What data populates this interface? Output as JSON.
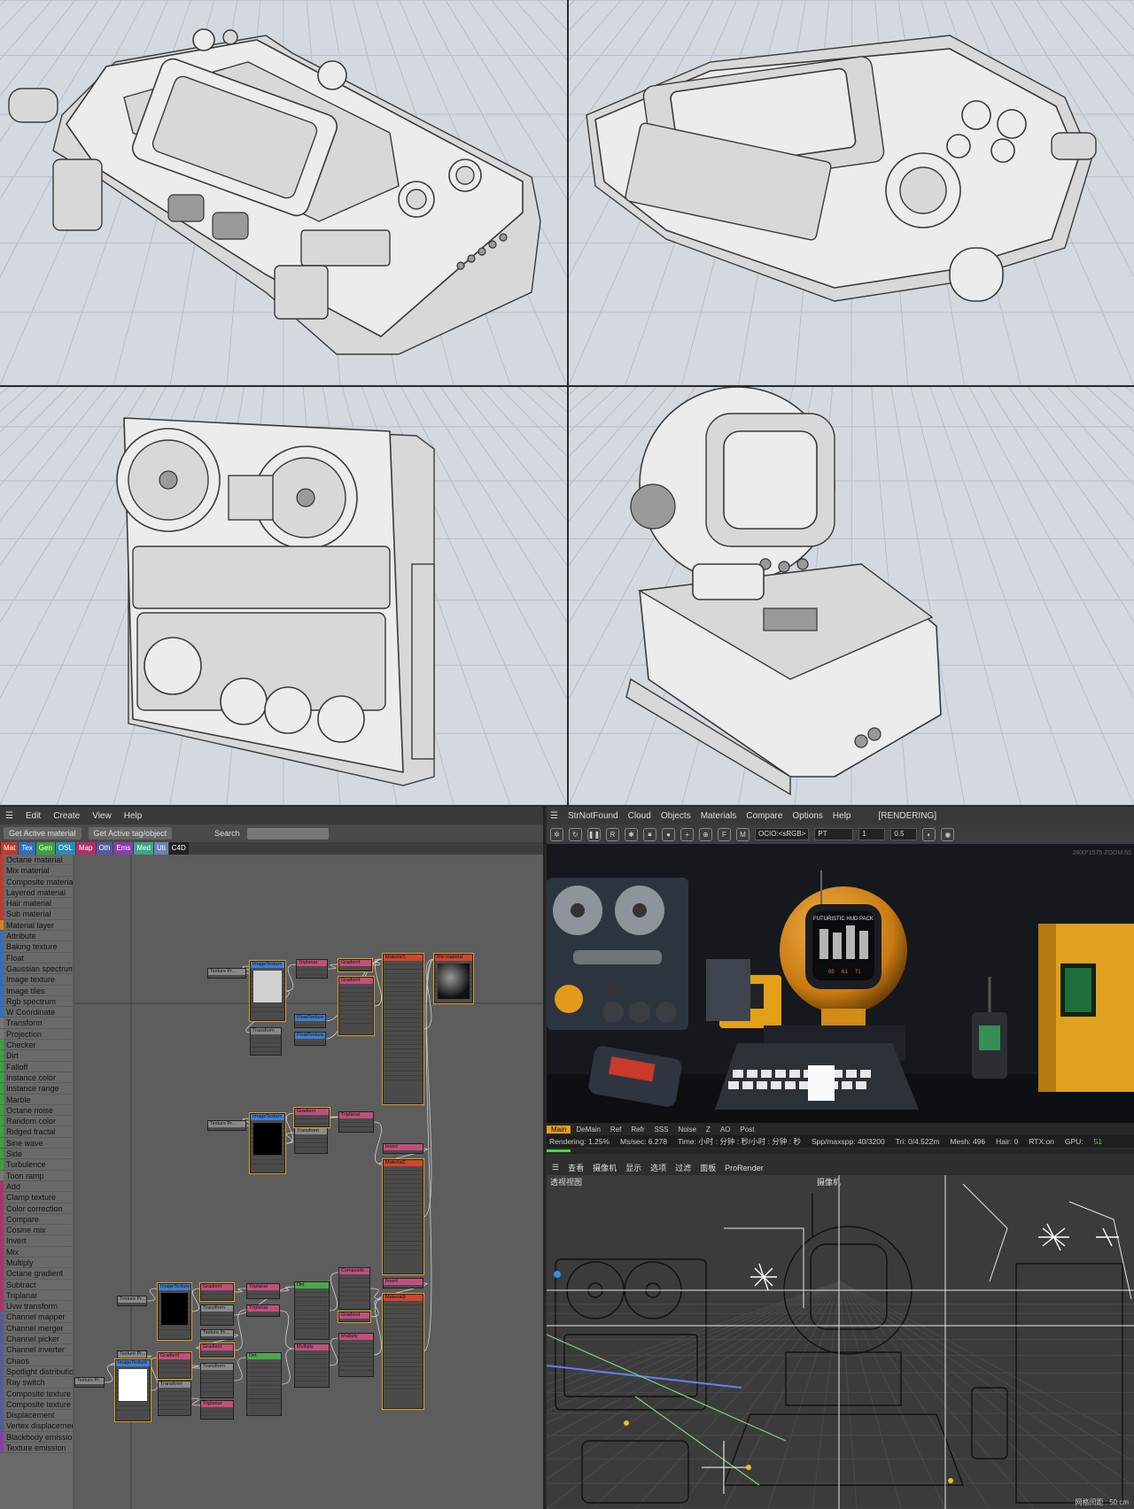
{
  "node_editor": {
    "menu": [
      "Edit",
      "Create",
      "View",
      "Help"
    ],
    "buttons": {
      "get_material": "Get Active material",
      "get_tag": "Get Active tag/object",
      "search_label": "Search"
    },
    "tabs": [
      {
        "label": "Mat",
        "color": "#c0392b"
      },
      {
        "label": "Tex",
        "color": "#2e6fbf"
      },
      {
        "label": "Gen",
        "color": "#39a539"
      },
      {
        "label": "OSL",
        "color": "#2a8ab5"
      },
      {
        "label": "Map",
        "color": "#b0306a"
      },
      {
        "label": "Oth",
        "color": "#555a9a"
      },
      {
        "label": "Ems",
        "color": "#8c3bb0"
      },
      {
        "label": "Med",
        "color": "#3ba58c"
      },
      {
        "label": "Uti",
        "color": "#6a84b5"
      },
      {
        "label": "C4D",
        "color": "#222222"
      }
    ],
    "categories": [
      {
        "label": "Octane material",
        "color": "#c0392b"
      },
      {
        "label": "Mix material",
        "color": "#c0392b"
      },
      {
        "label": "Composite material",
        "color": "#c0392b"
      },
      {
        "label": "Layered material",
        "color": "#c0392b"
      },
      {
        "label": "Hair material",
        "color": "#c0392b"
      },
      {
        "label": "Sub material",
        "color": "#c0392b"
      },
      {
        "label": "Material layer",
        "color": "#e07b20"
      },
      {
        "label": "Attribute",
        "color": "#2e6fbf"
      },
      {
        "label": "Baking texture",
        "color": "#2e6fbf"
      },
      {
        "label": "Float",
        "color": "#2e6fbf"
      },
      {
        "label": "Gaussian spectrum",
        "color": "#2e6fbf"
      },
      {
        "label": "Image texture",
        "color": "#2e6fbf"
      },
      {
        "label": "Image tiles",
        "color": "#2e6fbf"
      },
      {
        "label": "Rgb spectrum",
        "color": "#2e6fbf"
      },
      {
        "label": "W Coordinate",
        "color": "#2e6fbf"
      },
      {
        "label": "Transform",
        "color": "#777777"
      },
      {
        "label": "Projection",
        "color": "#777777"
      },
      {
        "label": "Checker",
        "color": "#39a539"
      },
      {
        "label": "Dirt",
        "color": "#39a539"
      },
      {
        "label": "Falloff",
        "color": "#39a539"
      },
      {
        "label": "Instance color",
        "color": "#39a539"
      },
      {
        "label": "Instance range",
        "color": "#39a539"
      },
      {
        "label": "Marble",
        "color": "#39a539"
      },
      {
        "label": "Octane noise",
        "color": "#39a539"
      },
      {
        "label": "Random color",
        "color": "#39a539"
      },
      {
        "label": "Ridged fractal",
        "color": "#39a539"
      },
      {
        "label": "Sine wave",
        "color": "#39a539"
      },
      {
        "label": "Side",
        "color": "#39a539"
      },
      {
        "label": "Turbulence",
        "color": "#39a539"
      },
      {
        "label": "Toon ramp",
        "color": "#777777"
      },
      {
        "label": "Add",
        "color": "#b0306a"
      },
      {
        "label": "Clamp texture",
        "color": "#b0306a"
      },
      {
        "label": "Color correction",
        "color": "#b0306a"
      },
      {
        "label": "Compare",
        "color": "#b0306a"
      },
      {
        "label": "Cosine mix",
        "color": "#b0306a"
      },
      {
        "label": "Invert",
        "color": "#b0306a"
      },
      {
        "label": "Mix",
        "color": "#b0306a"
      },
      {
        "label": "Multiply",
        "color": "#b0306a"
      },
      {
        "label": "Octane gradient",
        "color": "#b0306a"
      },
      {
        "label": "Subtract",
        "color": "#b0306a"
      },
      {
        "label": "Triplanar",
        "color": "#b0306a"
      },
      {
        "label": "Uvw transform",
        "color": "#b0306a"
      },
      {
        "label": "Channel mapper",
        "color": "#555a9a"
      },
      {
        "label": "Channel merger",
        "color": "#555a9a"
      },
      {
        "label": "Channel picker",
        "color": "#555a9a"
      },
      {
        "label": "Channel inverter",
        "color": "#555a9a"
      },
      {
        "label": "Chaos",
        "color": "#555a9a"
      },
      {
        "label": "Spotlight distribution",
        "color": "#555a9a"
      },
      {
        "label": "Ray switch",
        "color": "#555a9a"
      },
      {
        "label": "Composite texture",
        "color": "#555a9a"
      },
      {
        "label": "Composite texture layer",
        "color": "#555a9a"
      },
      {
        "label": "Displacement",
        "color": "#555a9a"
      },
      {
        "label": "Vertex displacement",
        "color": "#555a9a"
      },
      {
        "label": "Blackbody emission",
        "color": "#8c3bb0"
      },
      {
        "label": "Texture emission",
        "color": "#8c3bb0"
      }
    ],
    "nodes": [
      {
        "title": "Texture Pr...",
        "kind": "util"
      },
      {
        "title": "ImageTexture",
        "kind": "tex"
      },
      {
        "title": "Transform",
        "kind": "util"
      },
      {
        "title": "Triplanar",
        "kind": "map"
      },
      {
        "title": "Gradient",
        "kind": "map"
      },
      {
        "title": "Gradient",
        "kind": "map"
      },
      {
        "title": "Material1",
        "kind": "mat"
      },
      {
        "title": "FloatTexture",
        "kind": "tex"
      },
      {
        "title": "FloatTexture",
        "kind": "tex"
      },
      {
        "title": "Texture Pr...",
        "kind": "util"
      },
      {
        "title": "ImageTexture",
        "kind": "tex"
      },
      {
        "title": "Transform",
        "kind": "util"
      },
      {
        "title": "Gradient",
        "kind": "map"
      },
      {
        "title": "Triplanar",
        "kind": "map"
      },
      {
        "title": "Invert",
        "kind": "map"
      },
      {
        "title": "Material2",
        "kind": "mat"
      },
      {
        "title": "Composite...",
        "kind": "map"
      },
      {
        "title": "Gradient",
        "kind": "map"
      },
      {
        "title": "Multiply",
        "kind": "map"
      },
      {
        "title": "Invert",
        "kind": "map"
      },
      {
        "title": "Material3",
        "kind": "mat"
      },
      {
        "title": "Texture Pr...",
        "kind": "util"
      },
      {
        "title": "ImageTexture",
        "kind": "tex"
      },
      {
        "title": "Gradient",
        "kind": "map"
      },
      {
        "title": "Triplanar",
        "kind": "map"
      },
      {
        "title": "Dirt",
        "kind": "gen"
      },
      {
        "title": "Transform",
        "kind": "util"
      },
      {
        "title": "Texture Pr...",
        "kind": "util"
      },
      {
        "title": "Gradient",
        "kind": "map"
      },
      {
        "title": "Triplanar",
        "kind": "map"
      },
      {
        "title": "Multiply",
        "kind": "map"
      },
      {
        "title": "Texture Pr...",
        "kind": "util"
      },
      {
        "title": "ImageTexture",
        "kind": "tex"
      },
      {
        "title": "Gradient",
        "kind": "map"
      },
      {
        "title": "Transform",
        "kind": "util"
      },
      {
        "title": "Transform",
        "kind": "util"
      },
      {
        "title": "Triplanar",
        "kind": "map"
      },
      {
        "title": "Dirt",
        "kind": "gen"
      },
      {
        "title": "Texture Pr...",
        "kind": "util"
      },
      {
        "title": "Mix material",
        "kind": "mat"
      }
    ]
  },
  "render_window": {
    "menu": [
      "StrNotFound",
      "Cloud",
      "Objects",
      "Materials",
      "Compare",
      "Options",
      "Help"
    ],
    "state": "[RENDERING]",
    "ocio": "OCIO:<sRGB>",
    "kernel": "PT",
    "value1": "1",
    "value2": "0.5",
    "resolution_overlay": "2800*1575 ZOOM:55",
    "hud_label": "FUTURISTIC HUD PACK",
    "scene_nums": [
      "95",
      "61",
      "71"
    ],
    "tabs": [
      "Main",
      "DeMain",
      "Ref",
      "Refr",
      "SSS",
      "Noise",
      "Z",
      "AO",
      "Post"
    ],
    "status": {
      "rendering": "Rendering: 1.25%",
      "ms": "Ms/sec: 6.278",
      "time": "Time: 小时 : 分钟 : 秒/小时 : 分钟 : 秒",
      "spp": "Spp/maxspp: 40/3200",
      "tri": "Tri: 0/4.522m",
      "mesh": "Mesh: 496",
      "hair": "Hair: 0",
      "rtx": "RTX:on",
      "gpu": "GPU:",
      "gpu_val": "51"
    },
    "progress": 0.0125
  },
  "c4d_viewport": {
    "menu": [
      "查看",
      "摄像机",
      "显示",
      "选项",
      "过滤",
      "面板",
      "ProRender"
    ],
    "view_title": "透视视图",
    "camera": "摄像机",
    "grid": "网格间距 : 50 cm"
  },
  "colors": {
    "viewport_bg": "#d3d9df",
    "accent": "#e0a020",
    "progress": "#4fd24a"
  }
}
